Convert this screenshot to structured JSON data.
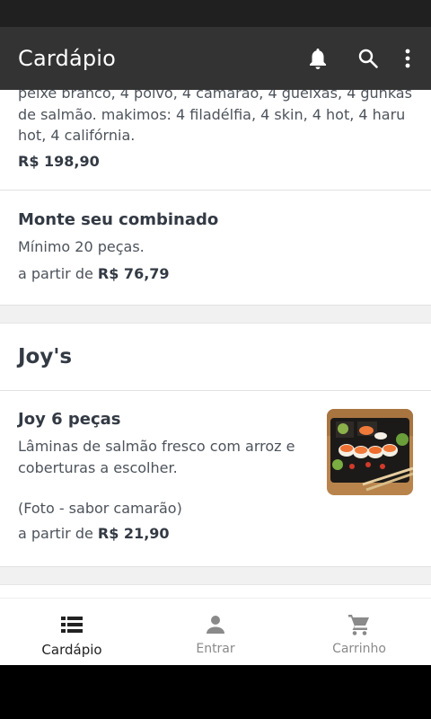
{
  "app_bar": {
    "title": "Cardápio"
  },
  "menu": {
    "partial_item": {
      "description": "peixe branco, 4 polvo, 4 camarão, 4 gueixas, 4 gunkas de salmão. makimos: 4 filadélfia, 4 skin, 4 hot, 4 haru hot, 4 califórnia.",
      "price": "R$ 198,90"
    },
    "combo_item": {
      "name": "Monte seu combinado",
      "description": "Mínimo 20 peças.",
      "price_prefix": "a partir de",
      "price": "R$ 76,79"
    },
    "section_title": "Joy's",
    "joy_item": {
      "name": "Joy 6 peças",
      "description": "Lâminas de salmão fresco com arroz e coberturas a escolher.",
      "note": "(Foto - sabor camarão)",
      "price_prefix": "a partir de",
      "price": "R$ 21,90"
    }
  },
  "bottom_nav": {
    "items": [
      {
        "label": "Cardápio",
        "icon": "list-icon",
        "active": true
      },
      {
        "label": "Entrar",
        "icon": "person-icon",
        "active": false
      },
      {
        "label": "Carrinho",
        "icon": "cart-icon",
        "active": false
      }
    ]
  },
  "colors": {
    "app_bar": "#333333",
    "text_primary": "#333a44",
    "text_secondary": "#4d535b",
    "nav_inactive": "#8a8a8a"
  }
}
